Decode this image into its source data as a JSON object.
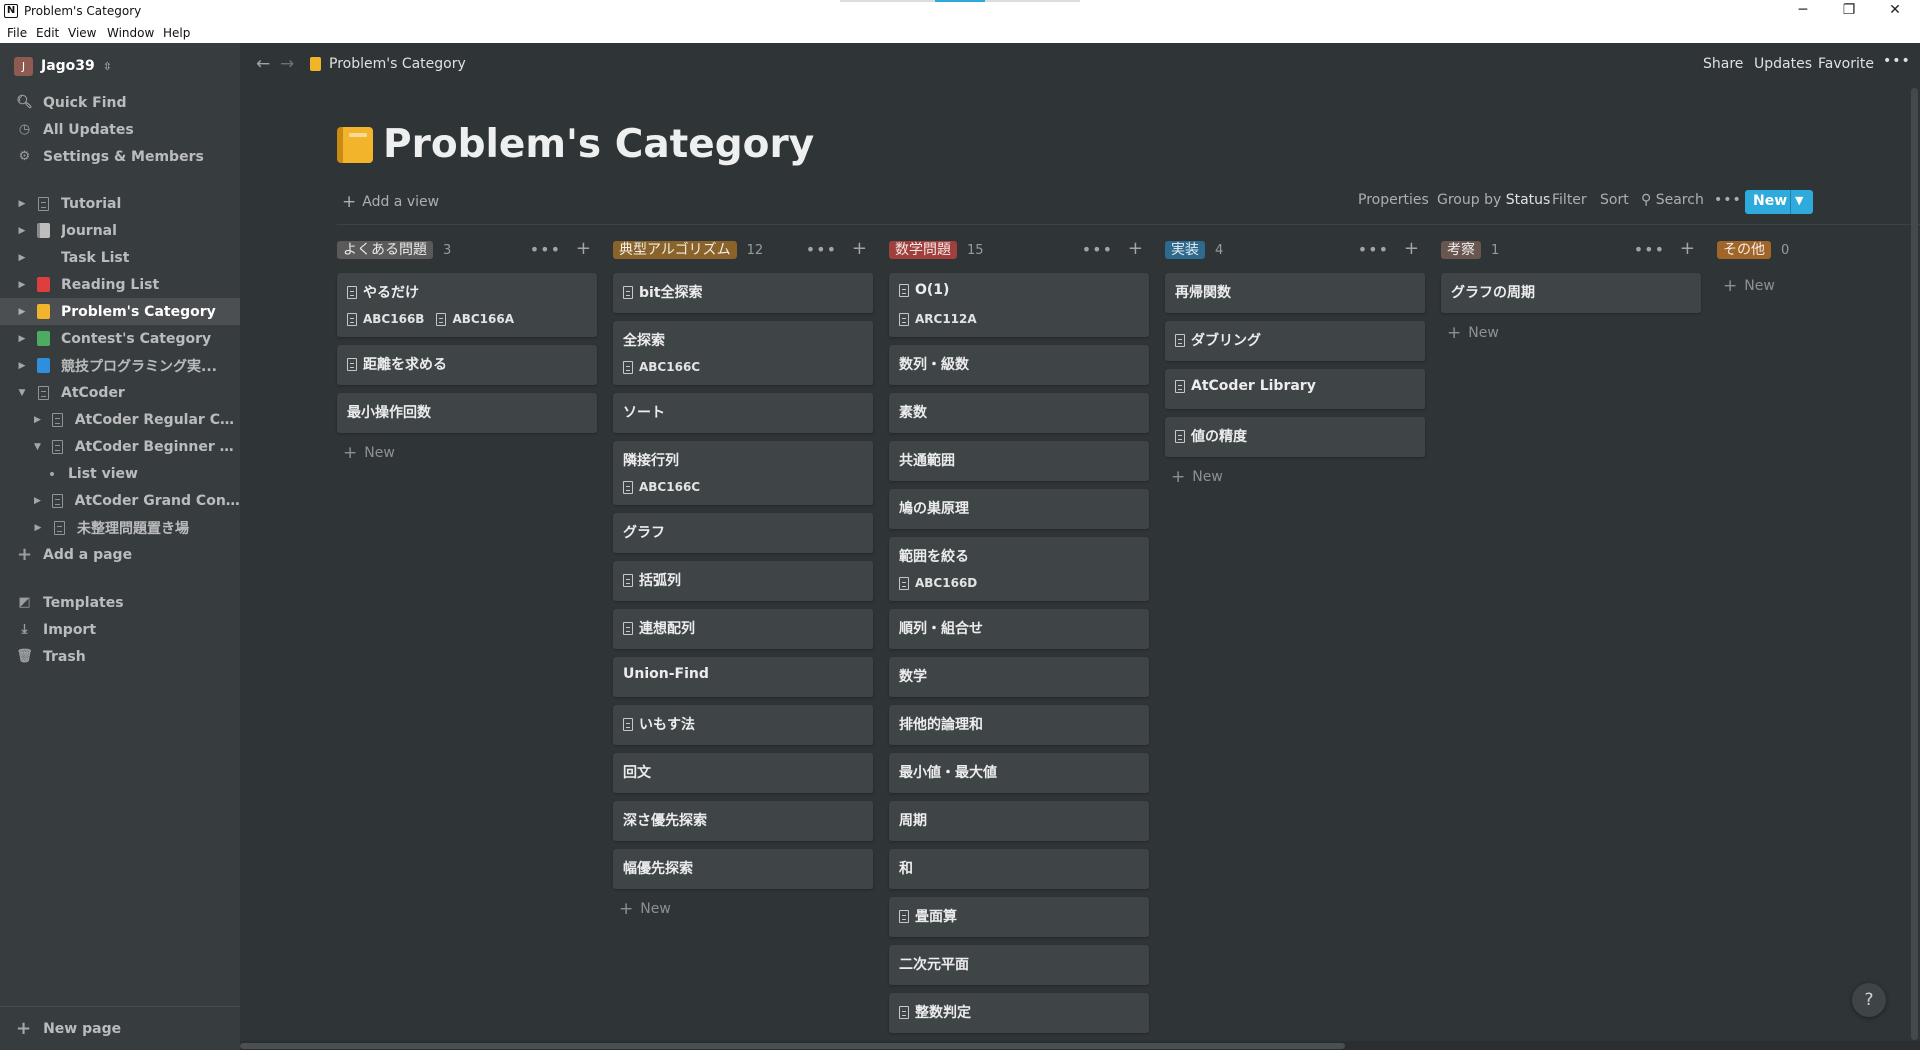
{
  "window": {
    "title": "Problem's Category",
    "minimize": "─",
    "maximize": "❐",
    "close": "✕"
  },
  "menu": [
    "File",
    "Edit",
    "View",
    "Window",
    "Help"
  ],
  "workspace": {
    "initial": "J",
    "name": "Jago39"
  },
  "sidebar": {
    "nav": [
      "Quick Find",
      "All Updates",
      "Settings & Members"
    ],
    "tree": [
      {
        "label": "Tutorial"
      },
      {
        "label": "Journal"
      },
      {
        "label": "Task List"
      },
      {
        "label": "Reading List",
        "color": "#e03e3e"
      },
      {
        "label": "Problem's Category",
        "color": "#f2b42a"
      },
      {
        "label": "Contest's Category",
        "color": "#4dab62"
      },
      {
        "label": "競技プログラミング実...",
        "color": "#2f8fdf"
      },
      {
        "label": "AtCoder"
      },
      {
        "label": "AtCoder Regular Con..."
      },
      {
        "label": "AtCoder Beginner Co..."
      },
      {
        "label": "List view"
      },
      {
        "label": "AtCoder Grand Contest"
      },
      {
        "label": "未整理問題置き場"
      }
    ],
    "add_page": "Add a page",
    "bottom": [
      "Templates",
      "Import",
      "Trash"
    ],
    "new_page": "New page"
  },
  "topbar": {
    "breadcrumb": "Problem's Category",
    "actions": [
      "Share",
      "Updates",
      "Favorite"
    ],
    "more": "•••"
  },
  "page": {
    "title": "Problem's Category",
    "add_view": "Add a view"
  },
  "toolbar": {
    "properties": "Properties",
    "group_by": "Group by",
    "group_value": "Status",
    "filter": "Filter",
    "sort": "Sort",
    "search": "Search",
    "more": "•••",
    "new": "New"
  },
  "new_label": "New",
  "columns": [
    {
      "name": "よくある問題",
      "count": "3",
      "color": "#5a5a5a",
      "cards": [
        {
          "title": "やるだけ",
          "icon": true,
          "subs": [
            "ABC166B",
            "ABC166A"
          ]
        },
        {
          "title": "距離を求める",
          "icon": true
        },
        {
          "title": "最小操作回数"
        }
      ]
    },
    {
      "name": "典型アルゴリズム",
      "count": "12",
      "color": "#89632a",
      "cards": [
        {
          "title": "bit全探索",
          "icon": true
        },
        {
          "title": "全探索",
          "subs": [
            "ABC166C"
          ]
        },
        {
          "title": "ソート"
        },
        {
          "title": "隣接行列",
          "subs": [
            "ABC166C"
          ]
        },
        {
          "title": "グラフ"
        },
        {
          "title": "括弧列",
          "icon": true
        },
        {
          "title": "連想配列",
          "icon": true
        },
        {
          "title": "Union-Find"
        },
        {
          "title": "いもす法",
          "icon": true
        },
        {
          "title": "回文"
        },
        {
          "title": "深さ優先探索"
        },
        {
          "title": "幅優先探索"
        }
      ]
    },
    {
      "name": "数学問題",
      "count": "15",
      "color": "#a0403c",
      "cards": [
        {
          "title": "O(1)",
          "icon": true,
          "subs": [
            "ARC112A"
          ]
        },
        {
          "title": "数列・級数"
        },
        {
          "title": "素数"
        },
        {
          "title": "共通範囲"
        },
        {
          "title": "鳩の巣原理"
        },
        {
          "title": "範囲を絞る",
          "subs": [
            "ABC166D"
          ]
        },
        {
          "title": "順列・組合せ"
        },
        {
          "title": "数学"
        },
        {
          "title": "排他的論理和"
        },
        {
          "title": "最小値・最大値"
        },
        {
          "title": "周期"
        },
        {
          "title": "和"
        },
        {
          "title": "畳面算",
          "icon": true
        },
        {
          "title": "二次元平面"
        },
        {
          "title": "整数判定",
          "icon": true
        }
      ]
    },
    {
      "name": "実装",
      "count": "4",
      "color": "#2d6a8e",
      "cards": [
        {
          "title": "再帰関数"
        },
        {
          "title": "ダブリング",
          "icon": true
        },
        {
          "title": "AtCoder Library",
          "icon": true
        },
        {
          "title": "値の精度",
          "icon": true
        }
      ]
    },
    {
      "name": "考察",
      "count": "1",
      "color": "#6a5651",
      "cards": [
        {
          "title": "グラフの周期"
        }
      ]
    },
    {
      "name": "その他",
      "count": "0",
      "color": "#a1652a",
      "cards": []
    }
  ],
  "help": "?"
}
